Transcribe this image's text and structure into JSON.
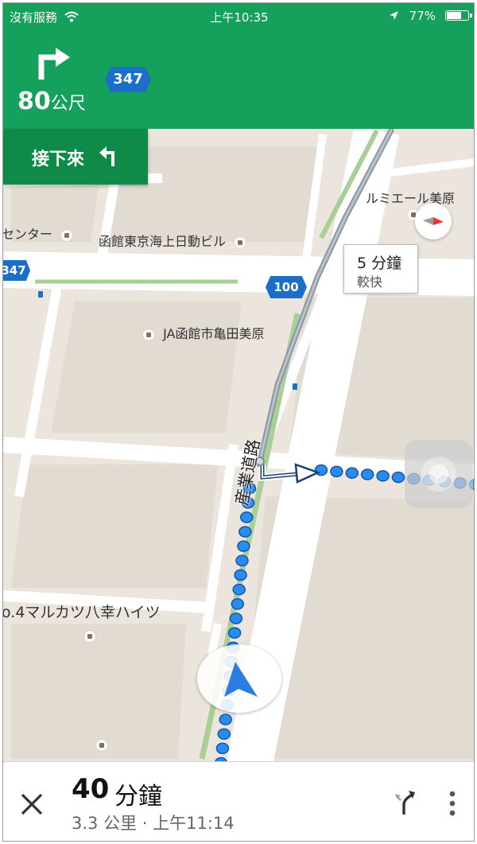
{
  "status_bar": {
    "carrier": "沒有服務",
    "time": "上午10:35",
    "battery_percent": "77%",
    "battery_level": 0.77
  },
  "navigation": {
    "maneuver": "turn-right",
    "distance_value": "80",
    "distance_unit": "公尺",
    "route_shield": "347",
    "next_label": "接下來",
    "next_maneuver": "turn-left"
  },
  "map": {
    "pois": [
      {
        "name": "ルミエール美原"
      },
      {
        "name": "センター"
      },
      {
        "name": "函館東京海上日動ビル"
      },
      {
        "name": "JA函館市亀田美原"
      },
      {
        "name": "o.4マルカツ八幸ハイツ"
      }
    ],
    "road_label": "産業道路",
    "shields": [
      "347",
      "100"
    ],
    "alt_route_callout": {
      "time": "5 分鐘",
      "note": "較快"
    }
  },
  "bottom_panel": {
    "eta_value": "40",
    "eta_unit": "分鐘",
    "detail": "3.3 公里 · 上午11:14"
  },
  "colors": {
    "header_green": "#15a05b",
    "next_green": "#0f8a48",
    "route_blue": "#2a8cf0",
    "alt_route_gray": "#9aa5ad"
  }
}
